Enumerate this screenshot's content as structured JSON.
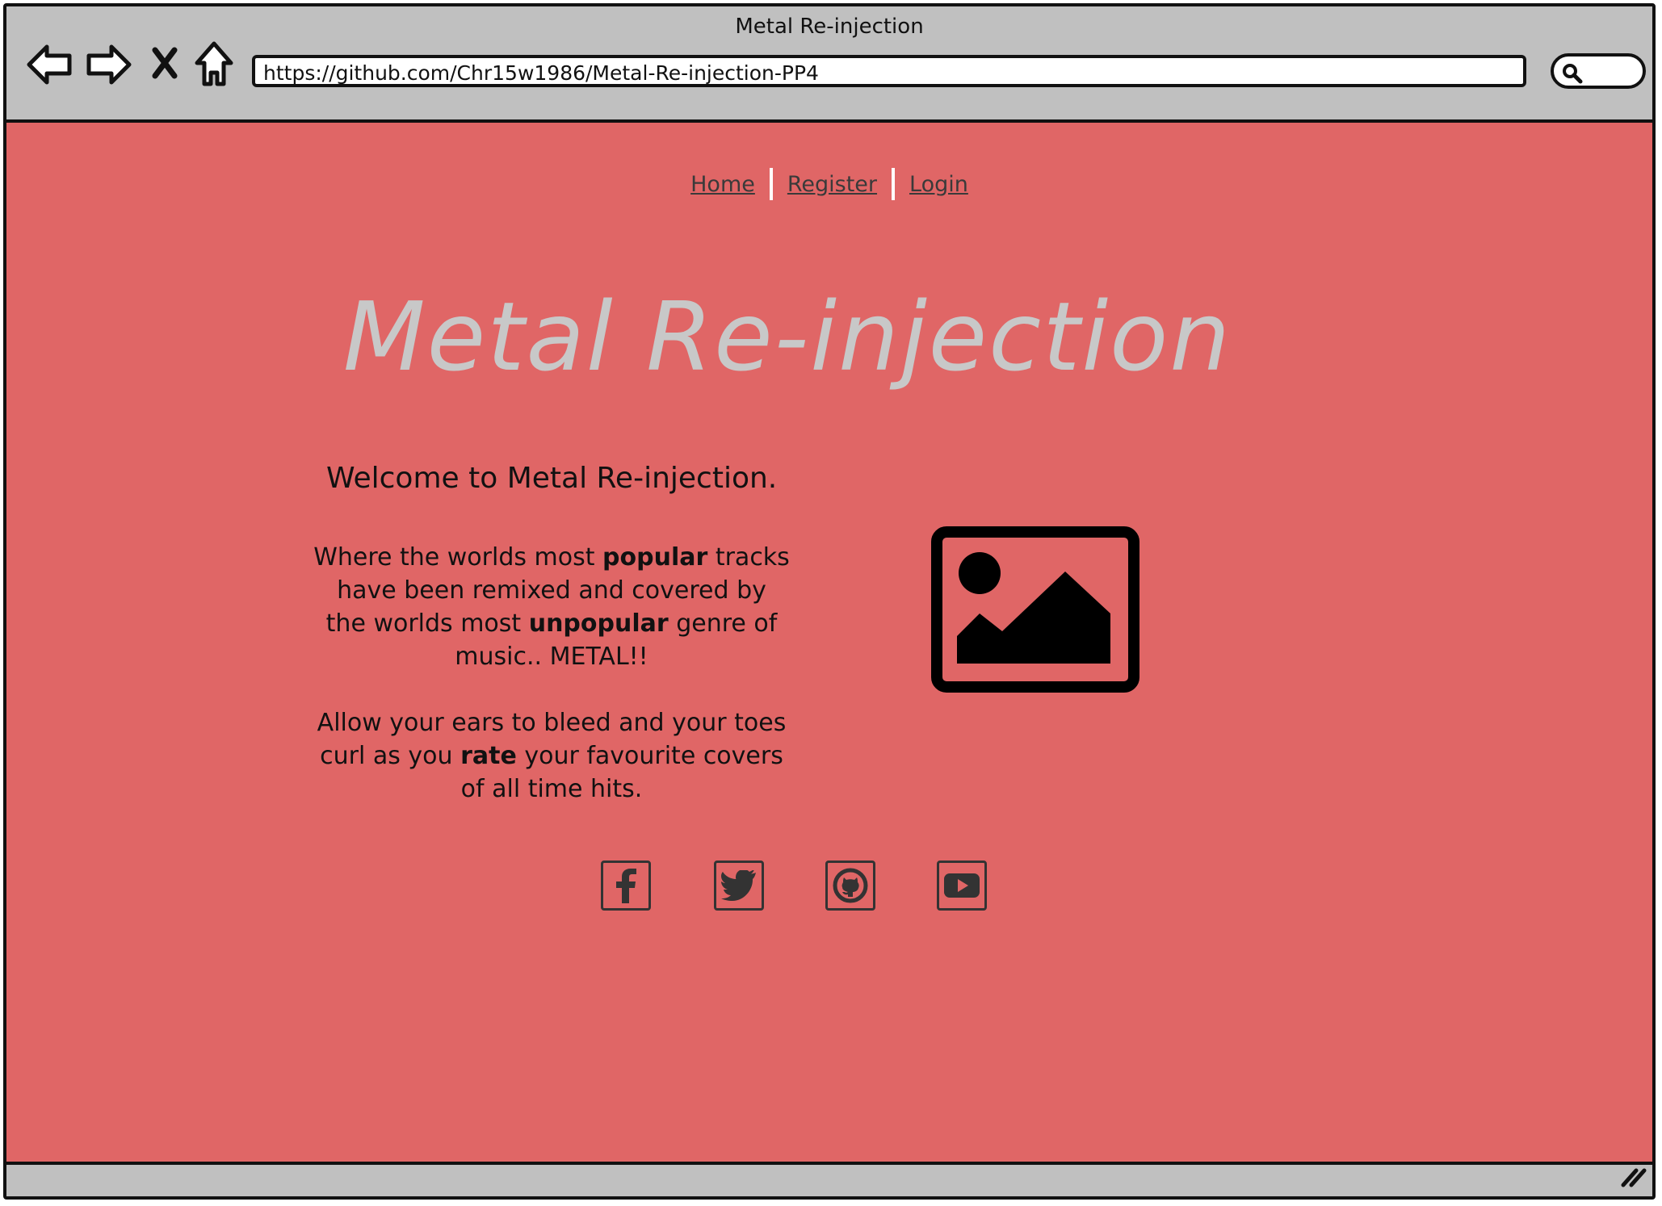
{
  "window": {
    "title": "Metal Re-injection",
    "url": "https://github.com/Chr15w1986/Metal-Re-injection-PP4"
  },
  "nav": {
    "links": [
      {
        "label": "Home"
      },
      {
        "label": "Register"
      },
      {
        "label": "Login"
      }
    ]
  },
  "hero": {
    "title": "Metal Re-injection"
  },
  "intro": {
    "welcome": "Welcome to Metal Re-injection.",
    "p1_a": "Where the worlds most ",
    "p1_b": "popular",
    "p1_c": " tracks have been remixed and covered by the worlds most ",
    "p1_d": "unpopular",
    "p1_e": " genre of music.. METAL!!",
    "p2_a": "Allow your ears to bleed and your toes curl as you ",
    "p2_b": "rate",
    "p2_c": " your favourite covers of all time hits."
  },
  "socials": [
    {
      "icon": "facebook-icon"
    },
    {
      "icon": "twitter-icon"
    },
    {
      "icon": "github-icon"
    },
    {
      "icon": "youtube-icon"
    }
  ],
  "colors": {
    "page_background": "#e06666",
    "chrome": "#c0c0c0",
    "hero_text": "#c8c8c8"
  }
}
